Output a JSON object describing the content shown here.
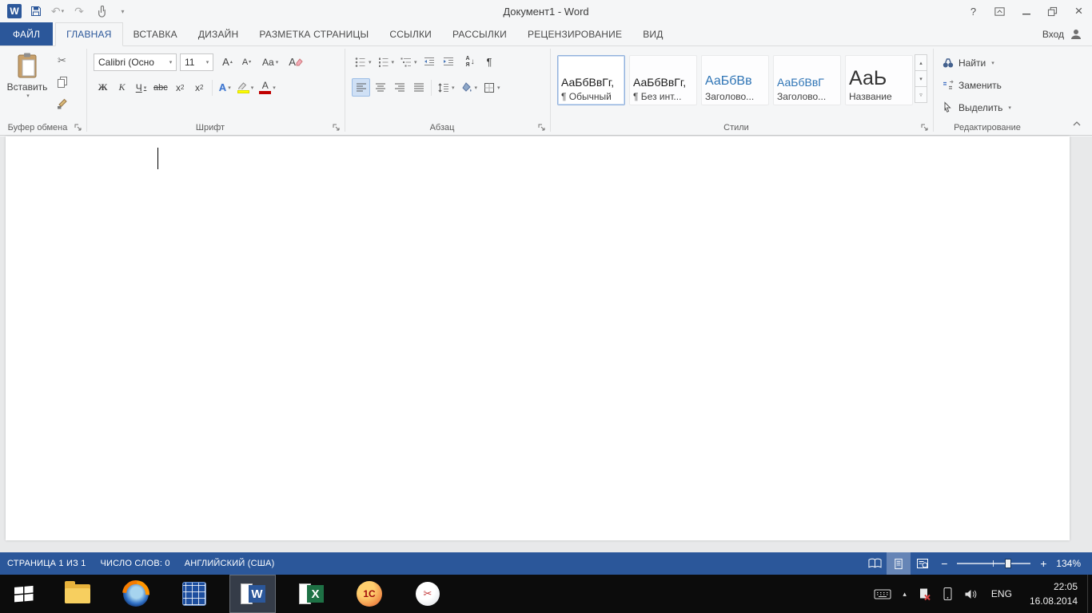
{
  "titlebar": {
    "title": "Документ1 - Word"
  },
  "account": {
    "sign_in": "Вход"
  },
  "tabs": {
    "file": "ФАЙЛ",
    "home": "ГЛАВНАЯ",
    "insert": "ВСТАВКА",
    "design": "ДИЗАЙН",
    "layout": "РАЗМЕТКА СТРАНИЦЫ",
    "references": "ССЫЛКИ",
    "mailings": "РАССЫЛКИ",
    "review": "РЕЦЕНЗИРОВАНИЕ",
    "view": "ВИД"
  },
  "clipboard": {
    "paste": "Вставить",
    "label": "Буфер обмена"
  },
  "font": {
    "label": "Шрифт",
    "name": "Calibri (Осно",
    "size": "11",
    "letter_a": "А",
    "case_aa": "Aa",
    "bold": "Ж",
    "italic": "К",
    "underline": "Ч",
    "strike": "abc",
    "x_letter": "х",
    "sub_2": "2",
    "sup_2": "2"
  },
  "paragraph": {
    "label": "Абзац",
    "sort_a": "А",
    "sort_ya": "Я",
    "pilcrow": "¶"
  },
  "styles": {
    "label": "Стили",
    "items": [
      {
        "preview": "АаБбВвГг,",
        "name": "¶ Обычный"
      },
      {
        "preview": "АаБбВвГг,",
        "name": "¶ Без инт..."
      },
      {
        "preview": "АаБбВв",
        "name": "Заголово..."
      },
      {
        "preview": "АаБбВвГ",
        "name": "Заголово..."
      },
      {
        "preview": "АаЬ",
        "name": "Название"
      }
    ]
  },
  "editing": {
    "label": "Редактирование",
    "find": "Найти",
    "replace": "Заменить",
    "select": "Выделить"
  },
  "statusbar": {
    "page": "СТРАНИЦА 1 ИЗ 1",
    "words": "ЧИСЛО СЛОВ: 0",
    "language": "АНГЛИЙСКИЙ (США)",
    "zoom": "134%"
  },
  "taskbar": {
    "lang": "ENG",
    "time": "22:05",
    "date": "16.08.2014",
    "word_letter": "W",
    "excel_letter": "X",
    "onec": "1С"
  },
  "icons": {
    "undo": "↶",
    "redo": "↷",
    "dropdown": "▾",
    "up_small": "▴",
    "down_small": "▾",
    "gallery_more": "▿",
    "help_q": "?",
    "close_x": "×",
    "cut_scissors": "✂",
    "down_arrow": "↓",
    "minus": "−",
    "plus": "+",
    "word_logo": "W"
  },
  "colors": {
    "accent": "#2b579a",
    "status_bar": "#2b579a",
    "taskbar": "#0c0c0c",
    "highlight": "#ffff00",
    "font_color": "#c00000"
  }
}
